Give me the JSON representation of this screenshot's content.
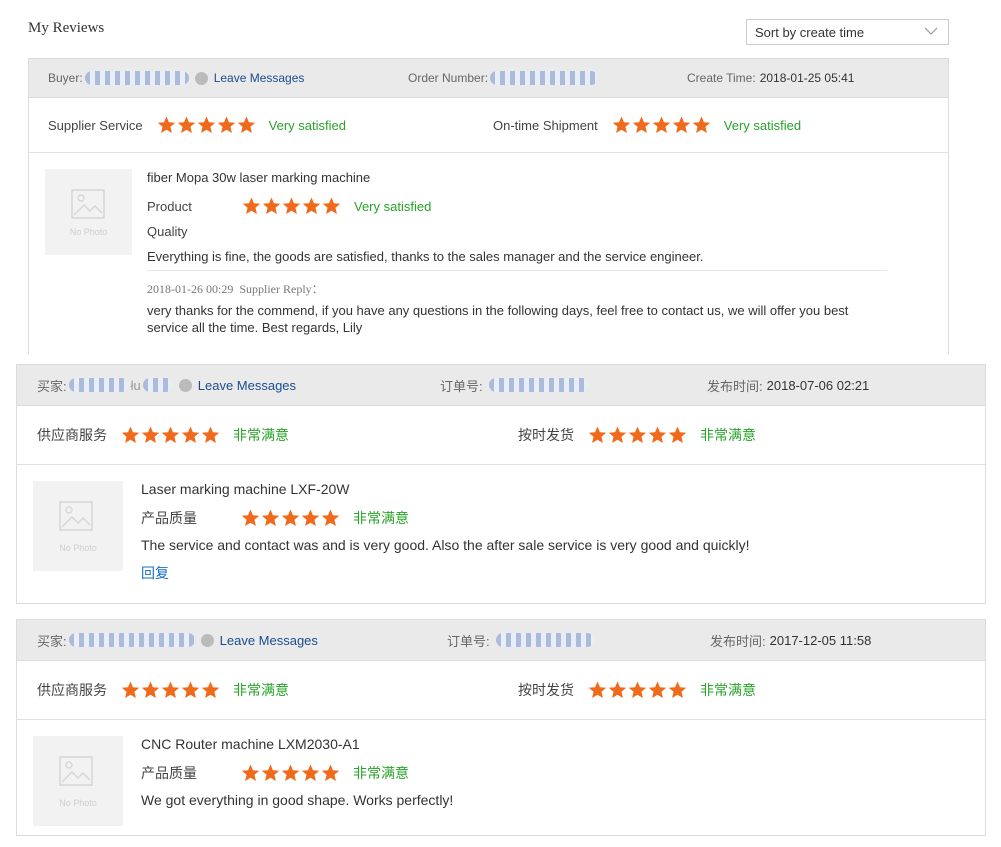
{
  "page": {
    "title": "My Reviews"
  },
  "sort": {
    "selected": "Sort by create time"
  },
  "colors": {
    "star": "#f06a1c",
    "satisfied": "#27a327",
    "link": "#1a4d8f",
    "header_bg": "#eaeaea"
  },
  "reviews": [
    {
      "buyer_label": "Buyer:",
      "leave_messages": "Leave Messages",
      "order_label": "Order Number:",
      "time_label": "Create Time:",
      "time_value": "2018-01-25 05:41",
      "supplier_service_label": "Supplier Service",
      "supplier_service_verdict": "Very satisfied",
      "supplier_service_stars": 5,
      "shipment_label": "On-time Shipment",
      "shipment_verdict": "Very satisfied",
      "shipment_stars": 5,
      "product_name": "fiber Mopa 30w laser marking machine",
      "product_label": "Product",
      "quality_label": "Quality",
      "product_verdict": "Very satisfied",
      "product_stars": 5,
      "thumb_text": "No Photo",
      "comment": "Everything is fine, the goods are satisfied, thanks to the sales manager and the service engineer.",
      "reply_time": "2018-01-26 00:29",
      "reply_label": "Supplier Reply：",
      "reply_text": "very thanks for the commend, if you have any questions in the following days, feel free to contact us, we will offer you best service all the time. Best regards, Lily"
    },
    {
      "buyer_label": "买家:",
      "buyer_visible_fragment": "łu",
      "leave_messages": "Leave Messages",
      "order_label": "订单号:",
      "time_label": "发布时间:",
      "time_value": "2018-07-06 02:21",
      "supplier_service_label": "供应商服务",
      "supplier_service_verdict": "非常满意",
      "supplier_service_stars": 5,
      "shipment_label": "按时发货",
      "shipment_verdict": "非常满意",
      "shipment_stars": 5,
      "product_name": "Laser marking machine LXF-20W",
      "product_label": "产品质量",
      "product_verdict": "非常满意",
      "product_stars": 5,
      "thumb_text": "No Photo",
      "comment": "The service and contact was and is very good. Also the after sale service is very good and quickly!",
      "reply_link": "回复"
    },
    {
      "buyer_label": "买家:",
      "leave_messages": "Leave Messages",
      "order_label": "订单号:",
      "time_label": "发布时间:",
      "time_value": "2017-12-05 11:58",
      "supplier_service_label": "供应商服务",
      "supplier_service_verdict": "非常满意",
      "supplier_service_stars": 5,
      "shipment_label": "按时发货",
      "shipment_verdict": "非常满意",
      "shipment_stars": 5,
      "product_name": "CNC Router machine LXM2030-A1",
      "product_label": "产品质量",
      "product_verdict": "非常满意",
      "product_stars": 5,
      "thumb_text": "No Photo",
      "comment": "We got everything in good shape. Works perfectly!"
    }
  ]
}
